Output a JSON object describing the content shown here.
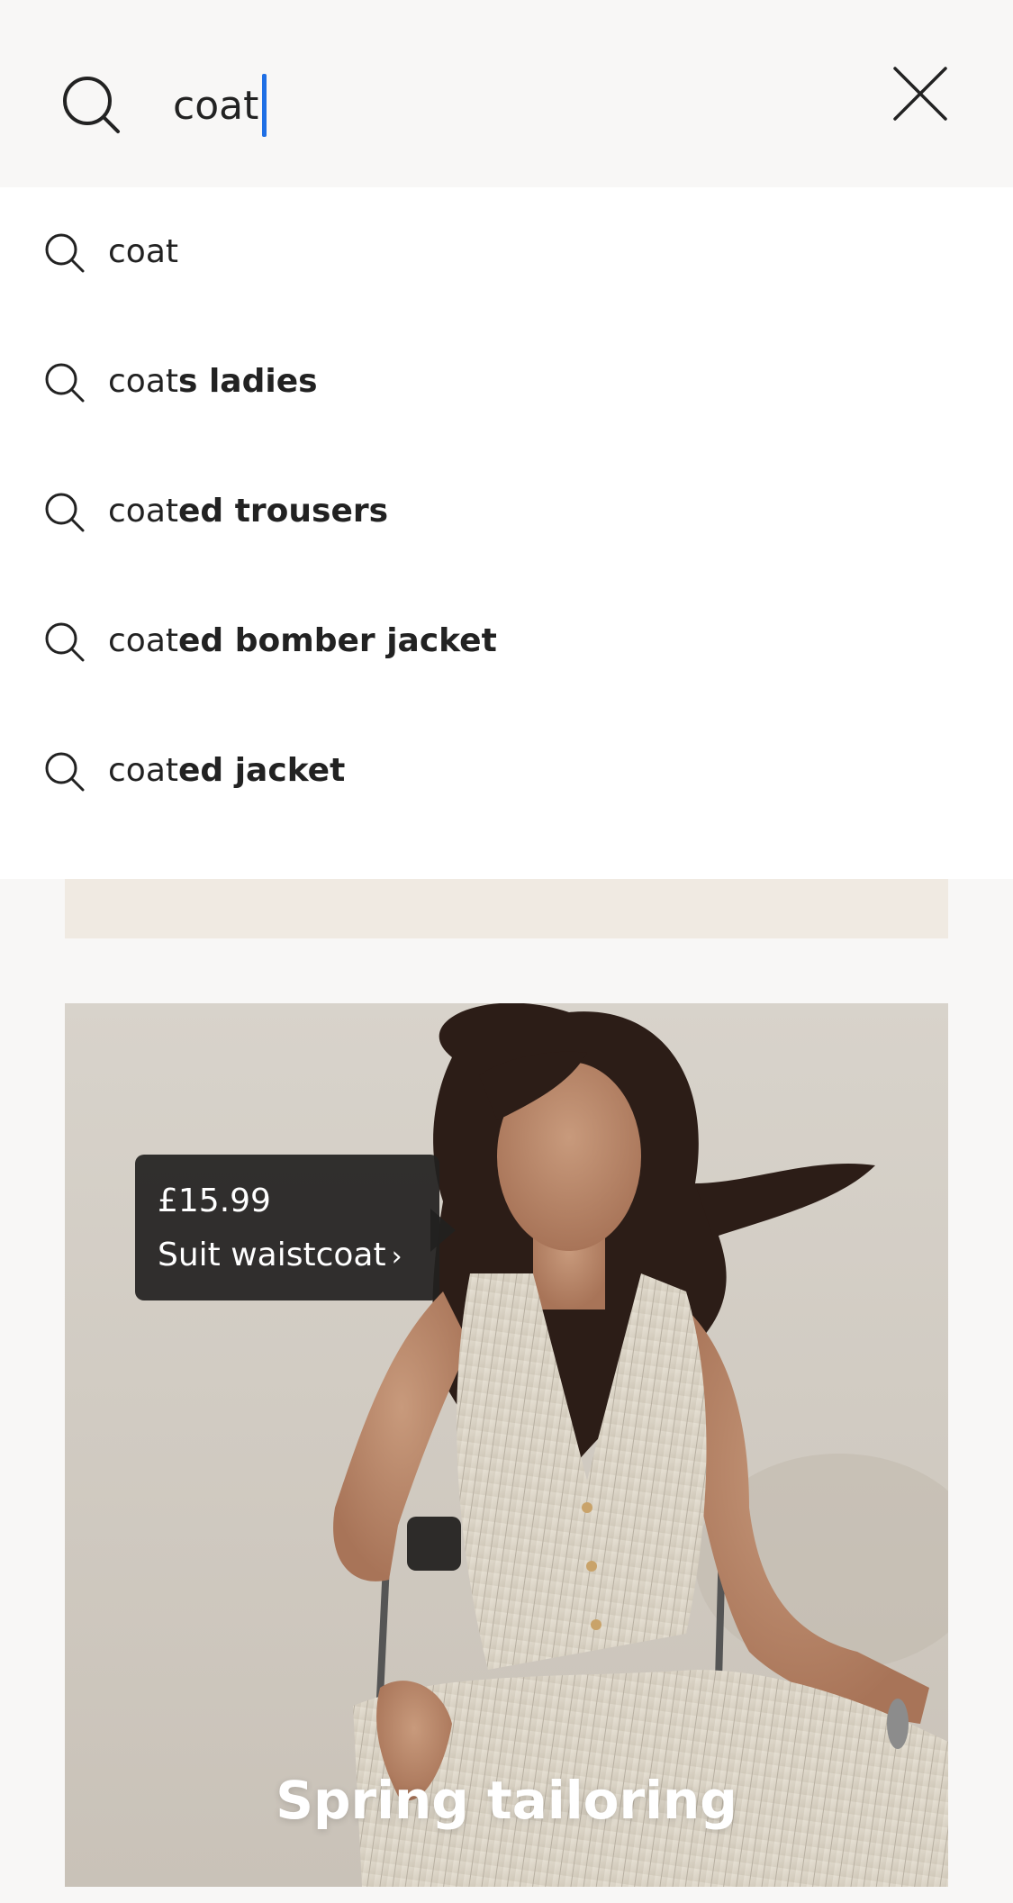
{
  "search": {
    "value": "coat",
    "icon": "search-icon",
    "close_icon": "close-icon",
    "caret_color": "#1f6fe5"
  },
  "suggestions": [
    {
      "typed": "coat",
      "completion": ""
    },
    {
      "typed": "coat",
      "completion": "s ladies"
    },
    {
      "typed": "coat",
      "completion": "ed trousers"
    },
    {
      "typed": "coat",
      "completion": "ed bomber jacket"
    },
    {
      "typed": "coat",
      "completion": "ed jacket"
    }
  ],
  "banner": {
    "color": "#f0eae2"
  },
  "hero": {
    "price": "£15.99",
    "product_name": "Suit waistcoat",
    "chevron": "›",
    "title": "Spring tailoring"
  }
}
